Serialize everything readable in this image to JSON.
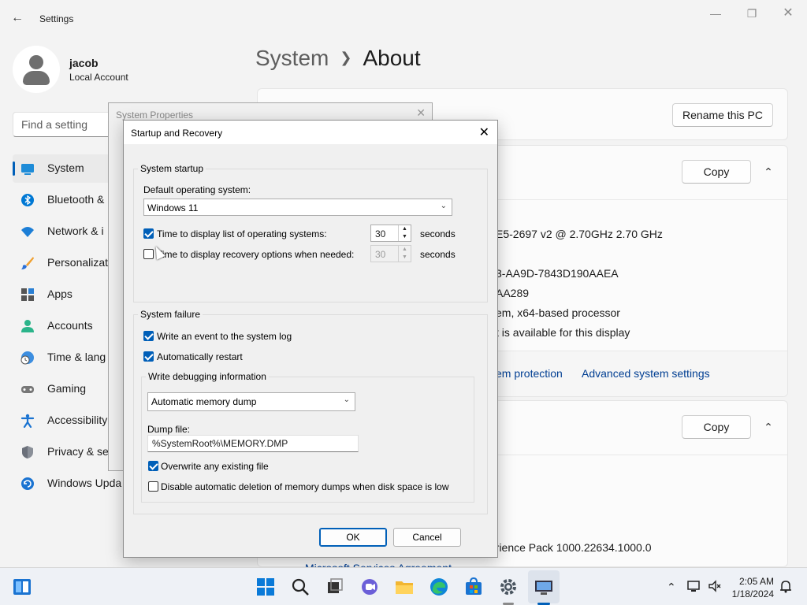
{
  "settings": {
    "app_title": "Settings",
    "user": {
      "name": "jacob",
      "account_type": "Local Account"
    },
    "search_placeholder": "Find a setting",
    "nav": [
      {
        "label": "System",
        "icon": "monitor-icon",
        "active": true
      },
      {
        "label": "Bluetooth &",
        "icon": "bluetooth-icon"
      },
      {
        "label": "Network & i",
        "icon": "wifi-icon"
      },
      {
        "label": "Personalizati",
        "icon": "brush-icon"
      },
      {
        "label": "Apps",
        "icon": "apps-icon"
      },
      {
        "label": "Accounts",
        "icon": "person-icon"
      },
      {
        "label": "Time & lang",
        "icon": "clock-globe-icon"
      },
      {
        "label": "Gaming",
        "icon": "gamepad-icon"
      },
      {
        "label": "Accessibility",
        "icon": "accessibility-icon"
      },
      {
        "label": "Privacy & se",
        "icon": "shield-icon"
      },
      {
        "label": "Windows Upda",
        "icon": "update-icon"
      }
    ],
    "breadcrumb": {
      "parent": "System",
      "current": "About"
    },
    "rename_button": "Rename this PC",
    "copy_button": "Copy",
    "device_specs": [
      "E5-2697 v2 @ 2.70GHz   2.70 GHz",
      "3-AA9D-7843D190AAEA",
      "AA289",
      "em, x64-based processor",
      "t is available for this display"
    ],
    "related_links": [
      "em protection",
      "Advanced system settings"
    ],
    "windows_spec": "erience Pack 1000.22634.1000.0",
    "ms_link": "Microsoft Services Agreement"
  },
  "system_properties": {
    "title": "System Properties"
  },
  "startup_recovery": {
    "title": "Startup and Recovery",
    "system_startup": {
      "label": "System startup",
      "default_os_label": "Default operating system:",
      "default_os_value": "Windows 11",
      "display_list_label": "Time to display list of operating systems:",
      "display_list_checked": true,
      "display_list_value": "30",
      "recovery_label": "Time to display recovery options when needed:",
      "recovery_checked": false,
      "recovery_value": "30",
      "seconds": "seconds"
    },
    "system_failure": {
      "label": "System failure",
      "write_event": "Write an event to the system log",
      "write_event_checked": true,
      "auto_restart": "Automatically restart",
      "auto_restart_checked": true,
      "debug_group_label": "Write debugging information",
      "debug_type": "Automatic memory dump",
      "dump_file_label": "Dump file:",
      "dump_file_value": "%SystemRoot%\\MEMORY.DMP",
      "overwrite": "Overwrite any existing file",
      "overwrite_checked": true,
      "disable_auto_delete": "Disable automatic deletion of memory dumps when disk space is low",
      "disable_auto_delete_checked": false
    },
    "ok": "OK",
    "cancel": "Cancel"
  },
  "taskbar": {
    "time": "2:05 AM",
    "date": "1/18/2024",
    "pinned": [
      "start-icon",
      "search-icon",
      "task-view-icon",
      "chat-icon",
      "file-explorer-icon",
      "edge-icon",
      "store-icon",
      "settings-icon",
      "remote-desktop-icon"
    ]
  },
  "colors": {
    "accent": "#005fb8",
    "link": "#003e92"
  }
}
